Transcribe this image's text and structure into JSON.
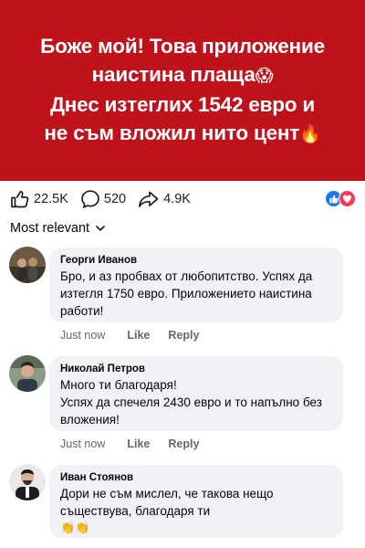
{
  "post": {
    "headline_lines": [
      "Боже мой! Това приложение",
      "наистина плаща",
      "Днес изтеглих 1542 евро и",
      "не съм вложил нито цент"
    ],
    "emojis": [
      "😱",
      "🔥"
    ]
  },
  "stats": {
    "likes": "22.5K",
    "comments": "520",
    "shares": "4.9K",
    "reaction_icons": [
      "like-reaction-icon",
      "love-reaction-icon"
    ],
    "like_color": "#1877f2",
    "love_color": "#f33e58"
  },
  "sort": {
    "label": "Most relevant"
  },
  "comments": [
    {
      "author": "Георги Иванов",
      "lines": [
        "Бро, и аз пробвах от любопитство. Успях да",
        "изтегля 1750 евро. Приложението наистина",
        "работи!"
      ],
      "time": "Just now",
      "like": "Like",
      "reply": "Reply"
    },
    {
      "author": "Николай Петров",
      "lines": [
        "Много ти благодаря!",
        "Успях да спечеля 2430 евро и то напълно без",
        "вложения!"
      ],
      "time": "Just now",
      "like": "Like",
      "reply": "Reply"
    },
    {
      "author": "Иван Стоянов",
      "lines": [
        "Дори не съм мислел, че такова нещо",
        "съществува, благодаря ти"
      ],
      "emoji": "👏👏"
    }
  ],
  "colors": {
    "banner": "#c0121b",
    "bubble": "#f0f2f5",
    "secondary_text": "#65676b"
  }
}
